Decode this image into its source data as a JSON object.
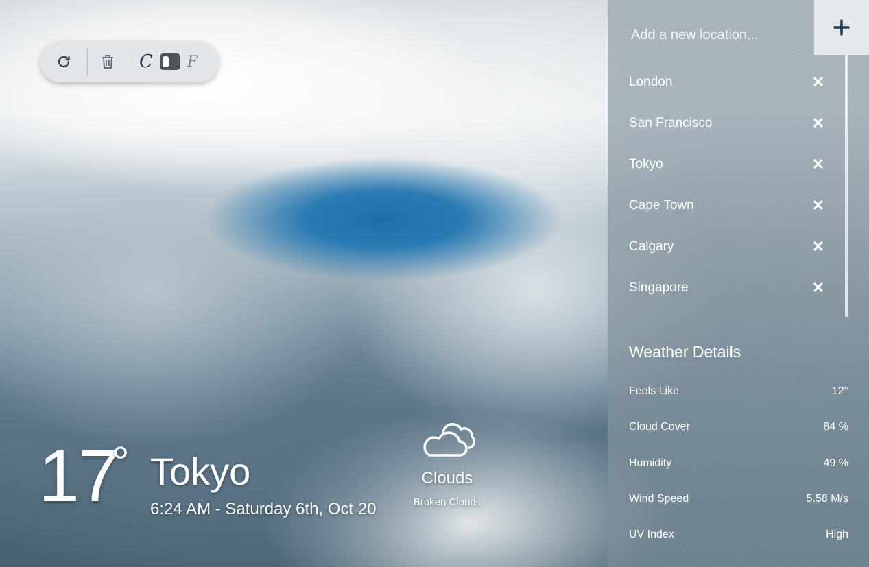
{
  "toolbar": {
    "refresh_icon": "refresh-icon",
    "delete_icon": "trash-icon",
    "unit_c": "C",
    "unit_f": "F"
  },
  "current": {
    "temperature": "17",
    "degree_symbol": "°",
    "city": "Tokyo",
    "datetime": "6:24 AM - Saturday 6th, Oct 20",
    "condition_icon": "clouds-icon",
    "condition": "Clouds",
    "condition_detail": "Broken Clouds"
  },
  "sidebar": {
    "search_placeholder": "Add a new location...",
    "add_label": "+",
    "locations": [
      {
        "name": "London",
        "remove": "✕"
      },
      {
        "name": "San Francisco",
        "remove": "✕"
      },
      {
        "name": "Tokyo",
        "remove": "✕"
      },
      {
        "name": "Cape Town",
        "remove": "✕"
      },
      {
        "name": "Calgary",
        "remove": "✕"
      },
      {
        "name": "Singapore",
        "remove": "✕"
      }
    ],
    "details_title": "Weather Details",
    "details": [
      {
        "label": "Feels Like",
        "value": "12°"
      },
      {
        "label": "Cloud Cover",
        "value": "84 %"
      },
      {
        "label": "Humidity",
        "value": "49 %"
      },
      {
        "label": "Wind Speed",
        "value": "5.58 M/s"
      },
      {
        "label": "UV Index",
        "value": "High"
      }
    ]
  },
  "colors": {
    "accent": "#2d3a45",
    "panel": "#8d9ba4"
  }
}
